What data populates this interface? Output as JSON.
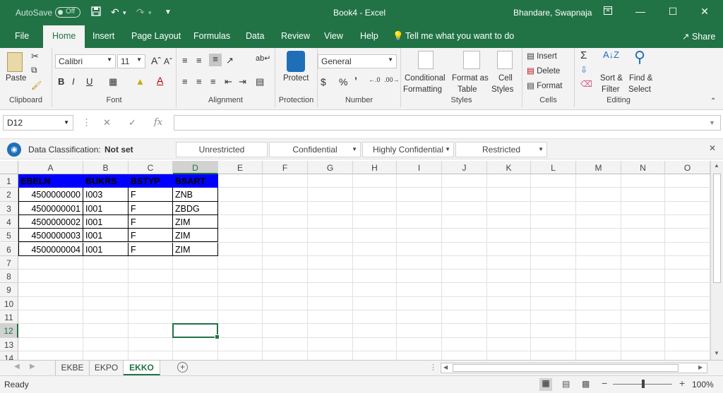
{
  "titlebar": {
    "autosave_label": "AutoSave",
    "autosave_state": "Off",
    "title": "Book4  -  Excel",
    "user": "Bhandare, Swapnaja"
  },
  "tabs": [
    "File",
    "Home",
    "Insert",
    "Page Layout",
    "Formulas",
    "Data",
    "Review",
    "View",
    "Help"
  ],
  "tell_me": "Tell me what you want to do",
  "share": "Share",
  "ribbon": {
    "clipboard": {
      "paste": "Paste",
      "label": "Clipboard"
    },
    "font": {
      "name": "Calibri",
      "size": "11",
      "label": "Font",
      "bold": "B",
      "italic": "I",
      "underline": "U"
    },
    "alignment": {
      "label": "Alignment"
    },
    "protection": {
      "protect": "Protect",
      "label": "Protection"
    },
    "number": {
      "format": "General",
      "label": "Number",
      "currency": "$",
      "percent": "%",
      "comma": "’"
    },
    "styles": {
      "conditional": "Conditional",
      "formatting": "Formatting",
      "format_as": "Format as",
      "table": "Table",
      "cell": "Cell",
      "cell_styles": "Styles",
      "label": "Styles"
    },
    "cells": {
      "insert": "Insert",
      "delete": "Delete",
      "format": "Format",
      "label": "Cells"
    },
    "editing": {
      "sort": "Sort &",
      "filter": "Filter",
      "find": "Find &",
      "select": "Select",
      "label": "Editing"
    }
  },
  "formula_bar": {
    "name_box": "D12",
    "fx": "fx",
    "value": ""
  },
  "classification": {
    "label": "Data Classification:",
    "value": "Not set",
    "options": [
      "Unrestricted",
      "Confidential",
      "Highly Confidential",
      "Restricted"
    ]
  },
  "columns": [
    "A",
    "B",
    "C",
    "D",
    "E",
    "F",
    "G",
    "H",
    "I",
    "J",
    "K",
    "L",
    "M",
    "N",
    "O"
  ],
  "rows": [
    "1",
    "2",
    "3",
    "4",
    "5",
    "6",
    "7",
    "8",
    "9",
    "10",
    "11",
    "12",
    "13",
    "14"
  ],
  "sheet": {
    "headers": [
      "EBELN",
      "BUKRS",
      "BSTYP",
      "BSART"
    ],
    "data": [
      [
        "4500000000",
        "I003",
        "F",
        "ZNB"
      ],
      [
        "4500000001",
        "I001",
        "F",
        "ZBDG"
      ],
      [
        "4500000002",
        "I001",
        "F",
        "ZIM"
      ],
      [
        "4500000003",
        "I001",
        "F",
        "ZIM"
      ],
      [
        "4500000004",
        "I001",
        "F",
        "ZIM"
      ]
    ]
  },
  "sheet_tabs": [
    "EKBE",
    "EKPO",
    "EKKO"
  ],
  "active_sheet": "EKKO",
  "status": {
    "ready": "Ready",
    "zoom": "100%"
  },
  "colors": {
    "excel_green": "#217346",
    "header_fill": "#0000ff"
  }
}
